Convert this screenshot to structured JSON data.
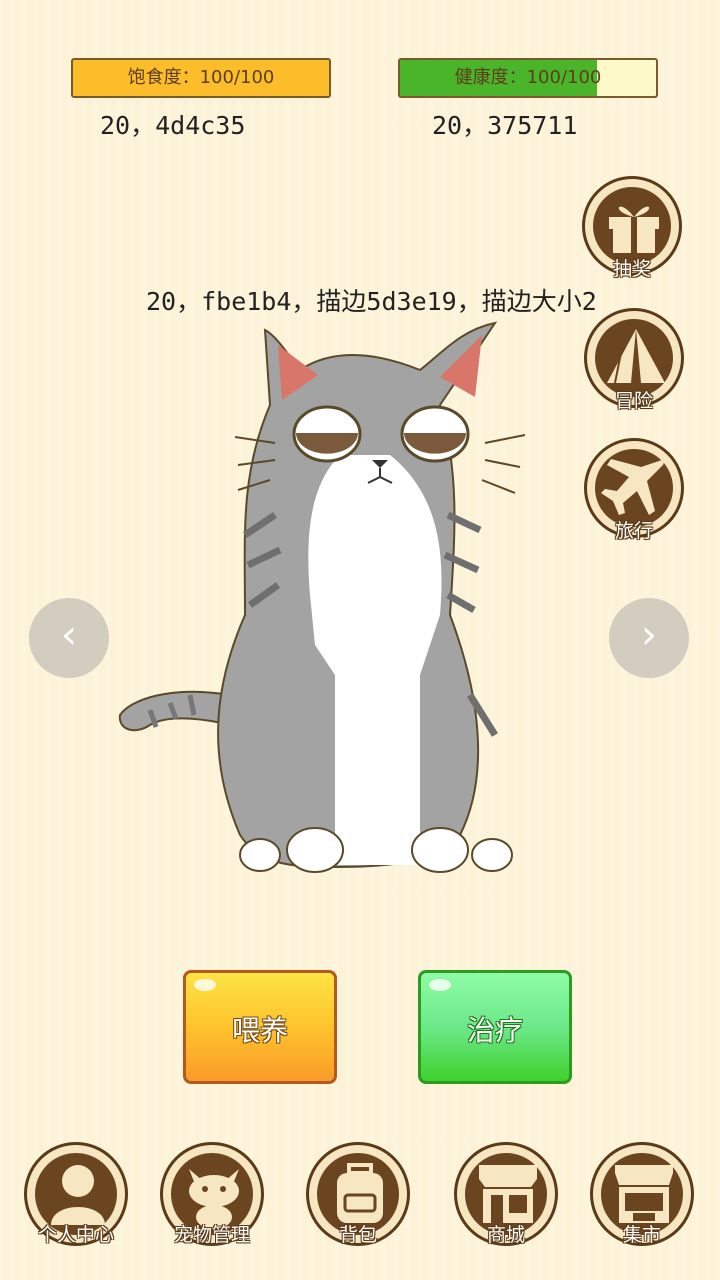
{
  "status": {
    "hunger": {
      "label": "饱食度：100/100",
      "value": 100,
      "max": 100,
      "fill_fraction": 1.0
    },
    "health": {
      "label": "健康度：100/100",
      "value": 100,
      "max": 100,
      "fill_fraction": 0.77
    }
  },
  "debug": {
    "hunger_note": "20，4d4c35",
    "health_note": "20，375711",
    "label_note": "20，fbe1b4，描边5d3e19，描边大小2"
  },
  "side_menu": [
    {
      "label": "抽奖",
      "icon": "gift-icon"
    },
    {
      "label": "冒险",
      "icon": "tent-icon"
    },
    {
      "label": "旅行",
      "icon": "airplane-icon"
    }
  ],
  "nav_arrows": {
    "prev": "‹",
    "next": "›"
  },
  "actions": {
    "feed": "喂养",
    "heal": "治疗"
  },
  "bottom_nav": [
    {
      "label": "个人中心",
      "icon": "person-icon"
    },
    {
      "label": "宠物管理",
      "icon": "cat-icon"
    },
    {
      "label": "背包",
      "icon": "backpack-icon"
    },
    {
      "label": "商城",
      "icon": "shop-icon"
    },
    {
      "label": "集市",
      "icon": "market-icon"
    }
  ],
  "colors": {
    "background": "#fdf4dc",
    "hunger_fill": "#fbbd2a",
    "health_fill": "#4ab52a",
    "brown": "#5b3a17"
  }
}
